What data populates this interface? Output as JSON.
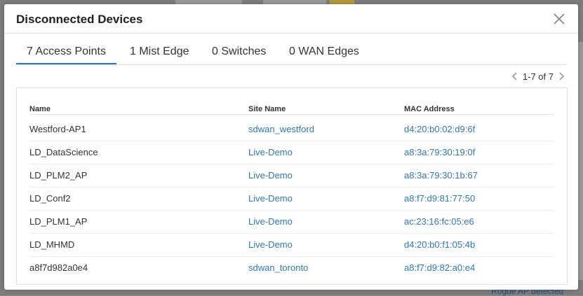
{
  "modal": {
    "title": "Disconnected Devices"
  },
  "tabs": [
    {
      "label": "7 Access Points",
      "active": true
    },
    {
      "label": "1 Mist Edge",
      "active": false
    },
    {
      "label": "0 Switches",
      "active": false
    },
    {
      "label": "0 WAN Edges",
      "active": false
    }
  ],
  "pagination": {
    "label": "1-7 of 7"
  },
  "table": {
    "headers": [
      "Name",
      "Site Name",
      "MAC Address"
    ],
    "rows": [
      [
        "Westford-AP1",
        "sdwan_westford",
        "d4:20:b0:02:d9:6f"
      ],
      [
        "LD_DataScience",
        "Live-Demo",
        "a8:3a:79:30:19:0f"
      ],
      [
        "LD_PLM2_AP",
        "Live-Demo",
        "a8:3a:79:30:1b:67"
      ],
      [
        "LD_Conf2",
        "Live-Demo",
        "a8:f7:d9:81:77:50"
      ],
      [
        "LD_PLM1_AP",
        "Live-Demo",
        "ac:23:16:fc:05:e6"
      ],
      [
        "LD_MHMD",
        "Live-Demo",
        "d4:20:b0:f1:05:4b"
      ],
      [
        "a8f7d982a0e4",
        "sdwan_toronto",
        "a8:f7:d9:82:a0:e4"
      ]
    ]
  },
  "background": {
    "bottom_text": "Rogue AP detected"
  },
  "colors": {
    "link": "#2f78b8",
    "tab_active": "#2f77b8"
  }
}
